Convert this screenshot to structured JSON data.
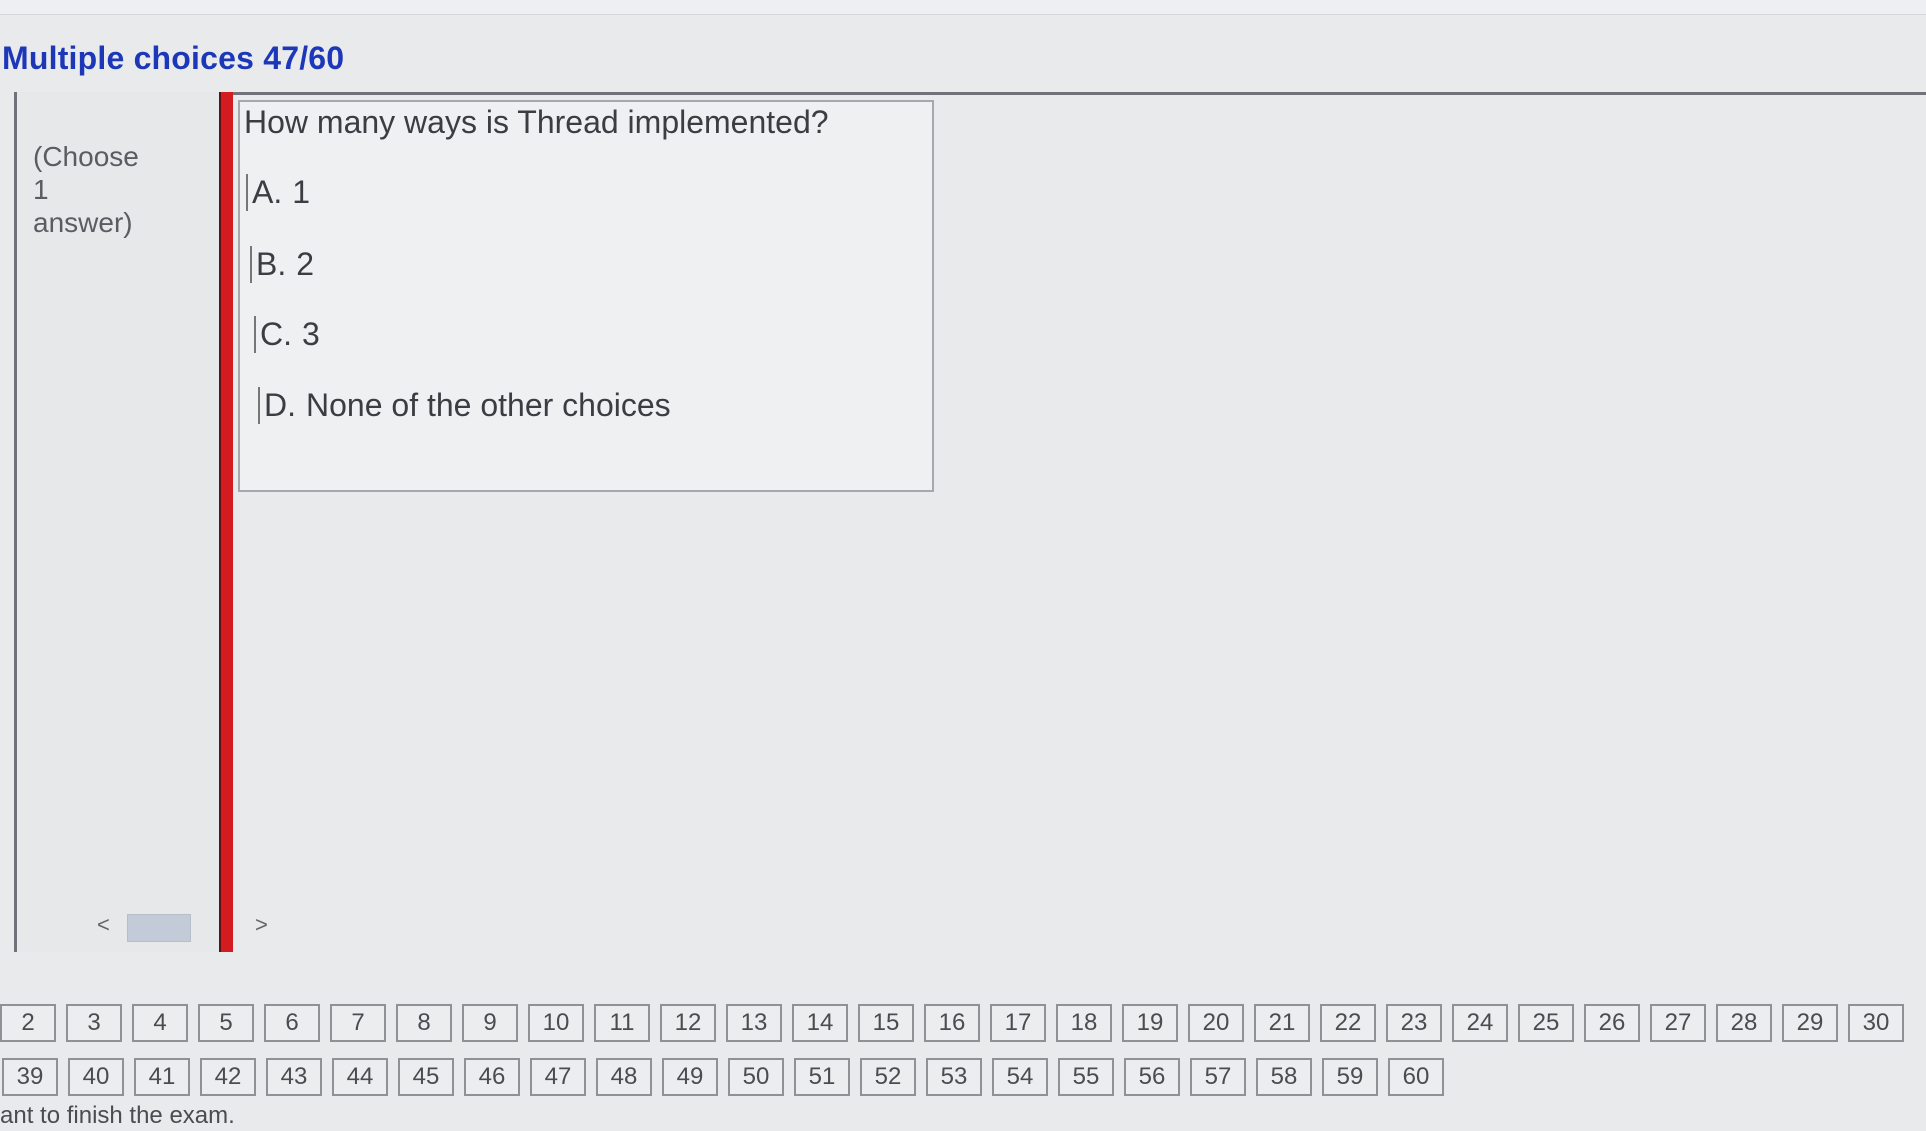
{
  "header": {
    "title": "Multiple choices 47/60"
  },
  "instructions": {
    "line1": "(Choose",
    "line2": "1",
    "line3": "answer)"
  },
  "scrollbar": {
    "left_arrow": "<",
    "right_arrow": ">"
  },
  "question": {
    "text": "How many ways is Thread implemented?",
    "choices": [
      {
        "letter": "A.",
        "text": "1"
      },
      {
        "letter": "B.",
        "text": "2"
      },
      {
        "letter": "C.",
        "text": "3"
      },
      {
        "letter": "D.",
        "text": "None of the other choices"
      }
    ]
  },
  "navigation": {
    "row1": [
      "2",
      "3",
      "4",
      "5",
      "6",
      "7",
      "8",
      "9",
      "10",
      "11",
      "12",
      "13",
      "14",
      "15",
      "16",
      "17",
      "18",
      "19",
      "20",
      "21",
      "22",
      "23",
      "24",
      "25",
      "26",
      "27",
      "28",
      "29",
      "30"
    ],
    "row2": [
      "39",
      "40",
      "41",
      "42",
      "43",
      "44",
      "45",
      "46",
      "47",
      "48",
      "49",
      "50",
      "51",
      "52",
      "53",
      "54",
      "55",
      "56",
      "57",
      "58",
      "59",
      "60"
    ]
  },
  "footer": {
    "text": "ant to finish the exam."
  }
}
